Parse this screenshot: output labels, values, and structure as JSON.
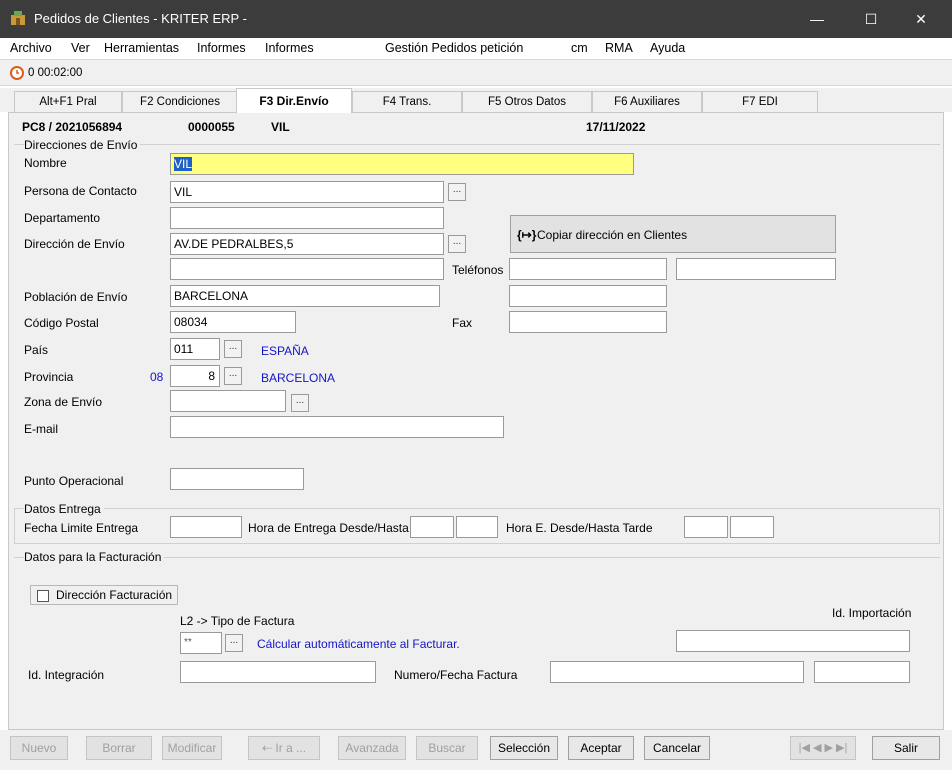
{
  "window": {
    "title": "Pedidos de Clientes - KRITER ERP -",
    "minimize": "—",
    "maximize": "☐",
    "close": "✕"
  },
  "menu": [
    "Archivo",
    "Ver",
    "Herramientas",
    "Informes",
    "Informes",
    "Gestión Pedidos petición",
    "cm",
    "RMA",
    "Ayuda"
  ],
  "timer": "0 00:02:00",
  "tabs": [
    "Alt+F1 Pral",
    "F2 Condiciones",
    "F3 Dir.Envío",
    "F4 Trans.",
    "F5 Otros Datos",
    "F6 Auxiliares",
    "F7 EDI"
  ],
  "header": {
    "order": "PC8 / 2021056894",
    "code": "0000055",
    "client": "VIL",
    "date": "17/11/2022"
  },
  "shipping": {
    "section": "Direcciones de Envío",
    "name_label": "Nombre",
    "name_value": "VIL",
    "contact_label": "Persona de Contacto",
    "contact_value": "VIL",
    "department_label": "Departamento",
    "department_value": "",
    "address_label": "Dirección de Envío",
    "address_value": "AV.DE PEDRALBES,5",
    "address2_value": "",
    "copy_button": "Copiar dirección en Clientes",
    "phones_label": "Teléfonos",
    "phone1": "",
    "phone2": "",
    "city_label": "Población de Envío",
    "city_value": "BARCELONA",
    "zip_label": "Código Postal",
    "zip_value": "08034",
    "fax_label": "Fax",
    "fax_value": "",
    "country_label": "País",
    "country_code": "011",
    "country_name": "ESPAÑA",
    "province_label": "Provincia",
    "province_prefix": "08",
    "province_code": "8",
    "province_name": "BARCELONA",
    "zone_label": "Zona de Envío",
    "zone_value": "",
    "email_label": "E-mail",
    "email_value": "",
    "op_point_label": "Punto Operacional",
    "op_point_value": ""
  },
  "delivery": {
    "section": "Datos Entrega",
    "limit_label": "Fecha Limite Entrega",
    "hours_label": "Hora de Entrega Desde/Hasta",
    "evening_label": "Hora E. Desde/Hasta Tarde"
  },
  "billing": {
    "section": "Datos para la Facturación",
    "address_checkbox": "Dirección Facturación",
    "invoice_type_label": "L2 -> Tipo de Factura",
    "invoice_type_value": "**",
    "invoice_type_desc": "Cálcular automáticamente al Facturar.",
    "import_id_label": "Id. Importación",
    "integration_id_label": "Id. Integración",
    "invoice_number_label": "Numero/Fecha Factura"
  },
  "buttons": {
    "new": "Nuevo",
    "delete": "Borrar",
    "modify": "Modificar",
    "goto": "⇠ Ir a ...",
    "advanced": "Avanzada",
    "search": "Buscar",
    "selection": "Selección",
    "accept": "Aceptar",
    "cancel": "Cancelar",
    "exit": "Salir",
    "nav": "|◀ ◀ ▶ ▶|"
  },
  "colors": {
    "title_bar": "#3c3c3c",
    "highlight": "#ffff80",
    "link_blue": "#1515c8"
  }
}
